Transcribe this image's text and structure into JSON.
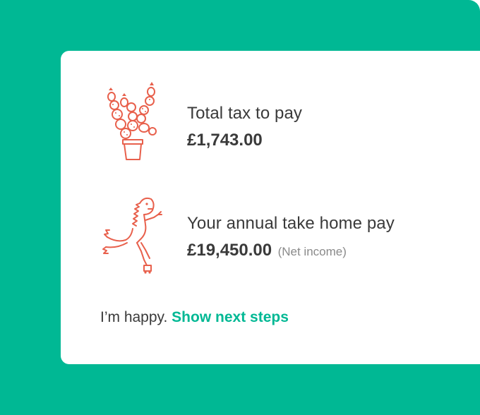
{
  "colors": {
    "frame_bg": "#00b894",
    "card_bg": "#ffffff",
    "text": "#3a3a3a",
    "muted": "#8a8a8a",
    "accent": "#00b894",
    "illustration": "#e8604c"
  },
  "tax": {
    "label": "Total tax to pay",
    "amount": "£1,743.00",
    "icon": "cactus-icon"
  },
  "take_home": {
    "label": "Your annual take home pay",
    "amount": "£19,450.00",
    "note": "(Net income)",
    "icon": "dinosaur-icon"
  },
  "footer": {
    "prefix": "I’m happy.",
    "link": "Show next steps"
  }
}
